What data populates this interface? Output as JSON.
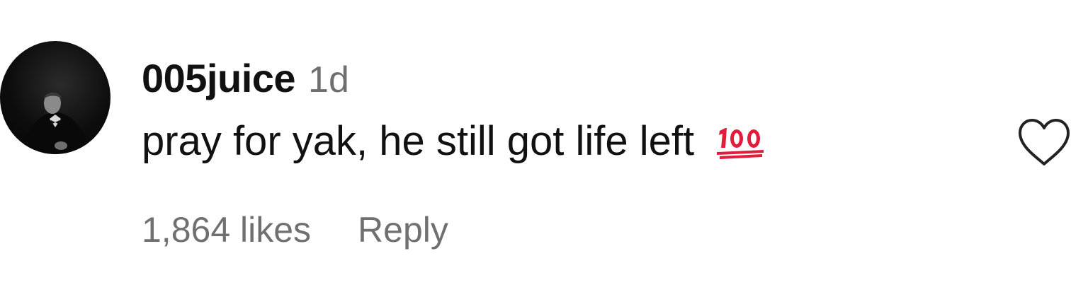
{
  "comment": {
    "username": "005juice",
    "time_ago": "1d",
    "text": "pray for yak, he still got life left",
    "emoji": "hundred-points-emoji",
    "likes_label": "1,864 likes",
    "reply_label": "Reply"
  },
  "icons": {
    "avatar": "profile-photo",
    "like": "heart-outline-icon"
  },
  "colors": {
    "text": "#111111",
    "secondary_text": "#707070",
    "emoji_red": "#e01e3c",
    "background": "#ffffff"
  }
}
